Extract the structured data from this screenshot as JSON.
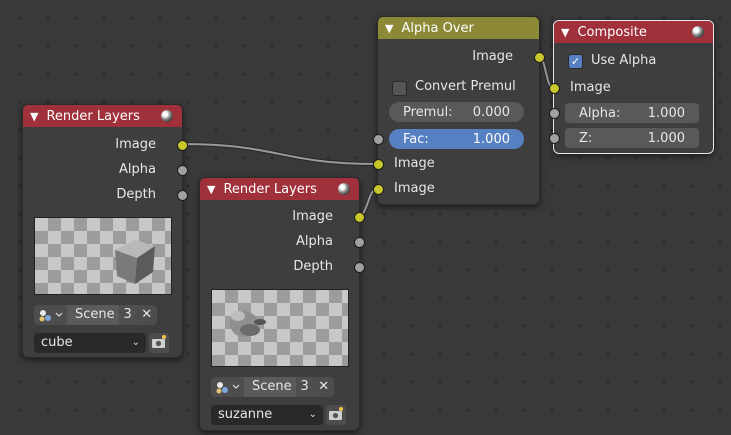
{
  "nodes": {
    "render_layers_1": {
      "title": "Render Layers",
      "outputs": [
        "Image",
        "Alpha",
        "Depth"
      ],
      "scene_label": "Scene",
      "scene_users": "3",
      "scene_clear": "✕",
      "layer": "cube"
    },
    "render_layers_2": {
      "title": "Render Layers",
      "outputs": [
        "Image",
        "Alpha",
        "Depth"
      ],
      "scene_label": "Scene",
      "scene_users": "3",
      "scene_clear": "✕",
      "layer": "suzanne"
    },
    "alpha_over": {
      "title": "Alpha Over",
      "output": "Image",
      "convert_premul_label": "Convert Premul",
      "convert_premul_checked": false,
      "premul_label": "Premul:",
      "premul_value": "0.000",
      "fac_label": "Fac:",
      "fac_value": "1.000",
      "inputs": [
        "Image",
        "Image"
      ]
    },
    "composite": {
      "title": "Composite",
      "use_alpha_label": "Use Alpha",
      "use_alpha_checked": true,
      "image_label": "Image",
      "alpha_label": "Alpha:",
      "alpha_value": "1.000",
      "z_label": "Z:",
      "z_value": "1.000"
    }
  },
  "colors": {
    "header_render_layers": "#a0303a",
    "header_alpha_over": "#8c8a37",
    "socket_color": "#c7c729",
    "socket_value": "#a1a1a1",
    "field_active": "#5680c2"
  }
}
